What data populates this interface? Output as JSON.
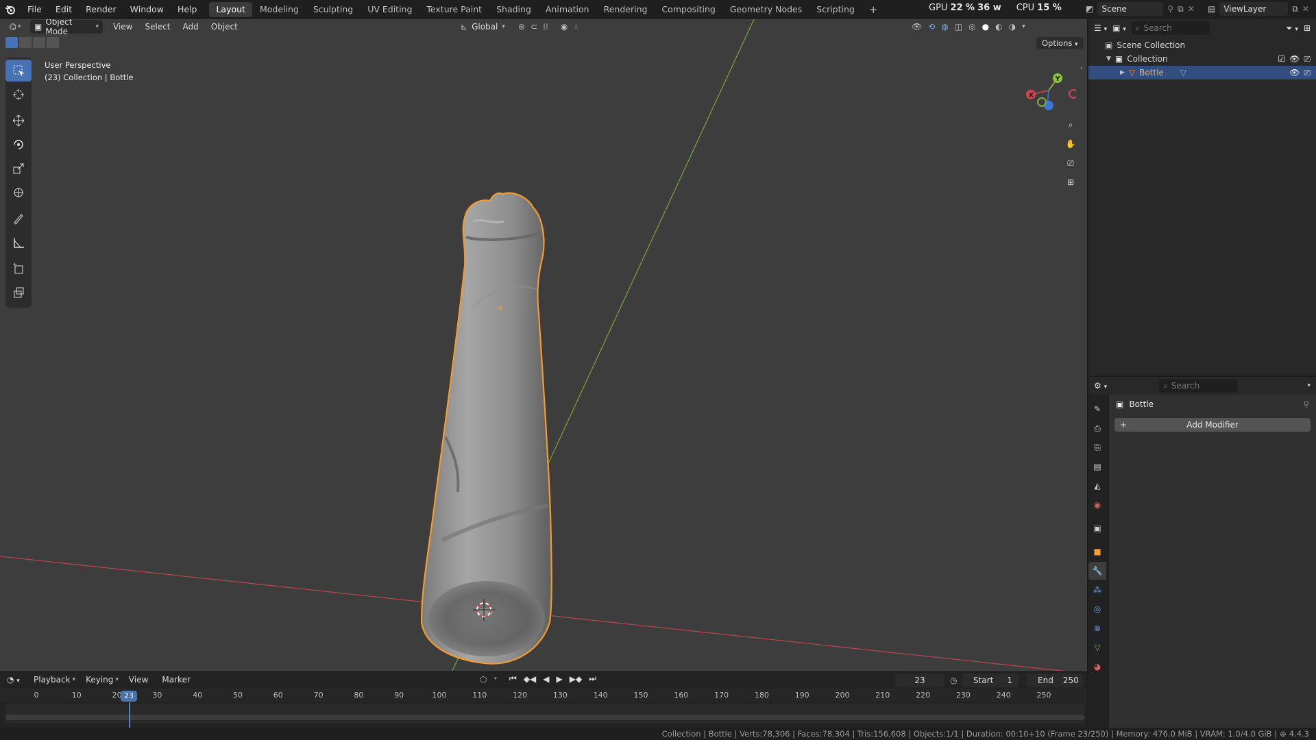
{
  "menubar": {
    "items": [
      "File",
      "Edit",
      "Render",
      "Window",
      "Help"
    ],
    "workspaces": [
      "Layout",
      "Modeling",
      "Sculpting",
      "UV Editing",
      "Texture Paint",
      "Shading",
      "Animation",
      "Rendering",
      "Compositing",
      "Geometry Nodes",
      "Scripting"
    ],
    "active_workspace": "Layout",
    "add_workspace": "+",
    "gpu_label": "GPU",
    "gpu_value": "22 %",
    "gpu_watts": "36 w",
    "cpu_label": "CPU",
    "cpu_value": "15 %",
    "scene": "Scene",
    "view_layer": "ViewLayer"
  },
  "viewport": {
    "mode": "Object Mode",
    "menus": [
      "View",
      "Select",
      "Add",
      "Object"
    ],
    "orientation": "Global",
    "options_label": "Options",
    "info_line1": "User Perspective",
    "info_line2": "(23) Collection | Bottle",
    "gizmo": {
      "x": "X",
      "y": "Y"
    },
    "colors": {
      "background": "#3d3d3d",
      "selection_outline": "#f39c2f",
      "x_axis": "#b8454f",
      "y_axis": "#6f9a2e",
      "active_tool": "#4772b3"
    }
  },
  "toolbar": {
    "tools": [
      "select-box-icon",
      "cursor-icon",
      "move-icon",
      "rotate-icon",
      "scale-icon",
      "transform-icon",
      "annotate-icon",
      "measure-icon",
      "add-cube-icon",
      "extrude-icon"
    ]
  },
  "timeline": {
    "menus": [
      "Playback",
      "Keying",
      "View",
      "Marker"
    ],
    "current_frame": "23",
    "start_label": "Start",
    "start_value": "1",
    "end_label": "End",
    "end_value": "250",
    "ruler": [
      "0",
      "10",
      "20",
      "30",
      "40",
      "50",
      "60",
      "70",
      "80",
      "90",
      "100",
      "110",
      "120",
      "130",
      "140",
      "150",
      "160",
      "170",
      "180",
      "190",
      "200",
      "210",
      "220",
      "230",
      "240",
      "250"
    ],
    "playhead_label": "23"
  },
  "outliner": {
    "search_placeholder": "Search",
    "scene_collection": "Scene Collection",
    "collection": "Collection",
    "object": "Bottle"
  },
  "properties": {
    "search_placeholder": "Search",
    "object_name": "Bottle",
    "add_modifier": "Add Modifier"
  },
  "statusbar": {
    "text": "Collection | Bottle | Verts:78,306 | Faces:78,304 | Tris:156,608 | Objects:1/1 | Duration: 00:10+10 (Frame 23/250) | Memory: 476.0 MiB | VRAM: 1.0/4.0 GiB |",
    "version": "4.4.3"
  }
}
